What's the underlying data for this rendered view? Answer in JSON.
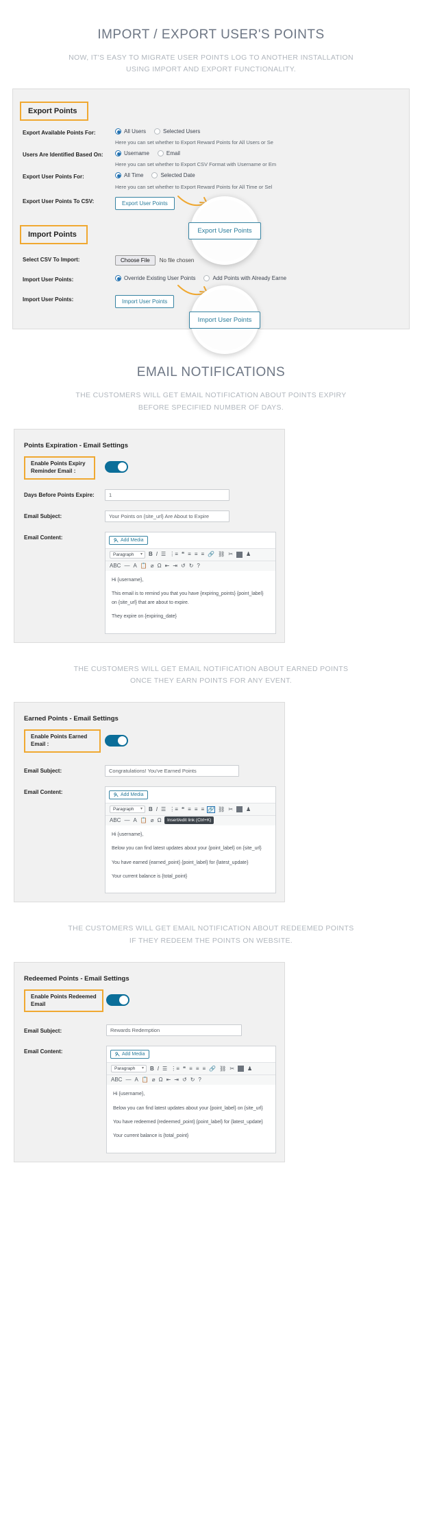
{
  "sections": {
    "import_export": {
      "title": "IMPORT / EXPORT USER'S POINTS",
      "subtitle": "NOW, IT'S EASY TO MIGRATE USER POINTS LOG TO ANOTHER INSTALLATION USING IMPORT AND EXPORT FUNCTIONALITY.",
      "export_legend": "Export Points",
      "import_legend": "Import Points",
      "rows": {
        "export_for_label": "Export Available Points For:",
        "export_for_opt1": "All Users",
        "export_for_opt2": "Selected Users",
        "export_for_hint": "Here you can set whether to Export Reward Points for All Users or Se",
        "identified_label": "Users Are Identified Based On:",
        "identified_opt1": "Username",
        "identified_opt2": "Email",
        "identified_hint": "Here you can set whether to Export CSV Format with Username or Em",
        "points_for_label": "Export User Points For:",
        "points_for_opt1": "All Time",
        "points_for_opt2": "Selected Date",
        "points_for_hint": "Here you can set whether to Export Reward Points for All Time or Sel",
        "to_csv_label": "Export User Points To CSV:",
        "to_csv_button": "Export User Points",
        "select_csv_label": "Select CSV To Import:",
        "choose_file_button": "Choose File",
        "no_file_text": "No file chosen",
        "import_mode_label": "Import User Points:",
        "import_mode_opt1": "Override Existing User Points",
        "import_mode_opt2": "Add Points with Already Earne",
        "import_action_label": "Import User Points:",
        "import_action_button": "Import User Points"
      },
      "magnifier_export_label": "Export User Points",
      "magnifier_import_label": "Import User Points"
    },
    "email_notifications": {
      "title": "EMAIL NOTIFICATIONS",
      "subtitle_expiry": "THE CUSTOMERS WILL GET EMAIL NOTIFICATION ABOUT POINTS EXPIRY BEFORE SPECIFIED NUMBER OF DAYS.",
      "subtitle_earned": "THE CUSTOMERS WILL GET EMAIL NOTIFICATION ABOUT EARNED POINTS ONCE THEY EARN POINTS FOR ANY EVENT.",
      "subtitle_redeemed": "THE CUSTOMERS WILL GET EMAIL NOTIFICATION ABOUT REDEEMED POINTS IF THEY REDEEM THE POINTS ON WEBSITE."
    }
  },
  "editor_toolbar": {
    "add_media": "Add Media",
    "paragraph": "Paragraph",
    "tooltip_link": "Insert/edit link (Ctrl+K)"
  },
  "panels": {
    "expiry": {
      "heading": "Points Expiration - Email Settings",
      "enable_label": "Enable Points Expiry Reminder Email :",
      "days_label": "Days Before Points Expire:",
      "days_value": "1",
      "subject_label": "Email Subject:",
      "subject_value": "Your Points on {site_url} Are About to Expire",
      "content_label": "Email Content:",
      "content_lines": [
        "Hi {username},",
        "This email is to remind you that you have {expiring_points} {point_label} on {site_url} that are about to expire.",
        "They expire on {expiring_date}"
      ]
    },
    "earned": {
      "heading": "Earned Points - Email Settings",
      "enable_label": "Enable Points Earned Email :",
      "subject_label": "Email Subject:",
      "subject_value": "Congratulations! You've Earned Points",
      "content_label": "Email Content:",
      "content_lines": [
        "Hi {username},",
        "Below  you can find  latest updates about your {point_label} on {site_url}",
        "You have earned {earned_point} {point_label} for {latest_update}",
        "Your current balance is {total_point}"
      ]
    },
    "redeemed": {
      "heading": "Redeemed Points - Email Settings",
      "enable_label": "Enable Points Redeemed Email",
      "subject_label": "Email Subject:",
      "subject_value": "Rewards Redemption",
      "content_label": "Email Content:",
      "content_lines": [
        "Hi {username},",
        "Below  you can find  latest updates about your {point_label} on {site_url}",
        "You have redeemed {redeemed_point} {point_label} for {latest_update}",
        "Your current balance is {total_point}"
      ]
    }
  },
  "colors": {
    "accent_orange": "#f0a830",
    "accent_blue": "#2a7c9b",
    "toggle_on": "#0b6e99",
    "heading_gray": "#6d7684",
    "subtitle_gray": "#b0b6bd"
  }
}
